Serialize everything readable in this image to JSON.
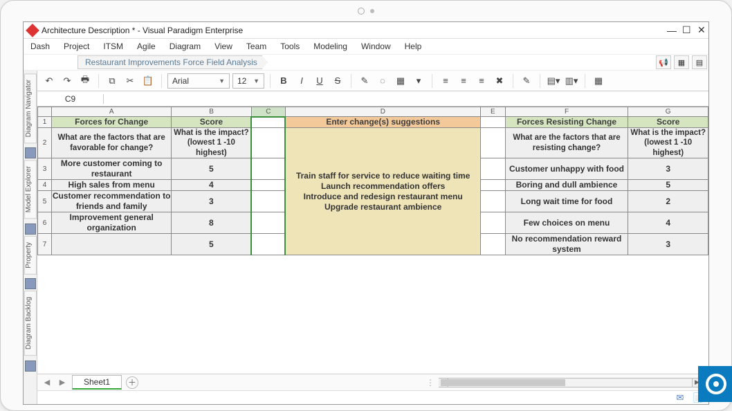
{
  "titlebar": {
    "title": "Architecture Description * - Visual Paradigm Enterprise"
  },
  "menu": [
    "Dash",
    "Project",
    "ITSM",
    "Agile",
    "Diagram",
    "View",
    "Team",
    "Tools",
    "Modeling",
    "Window",
    "Help"
  ],
  "breadcrumb": "Restaurant Improvements Force Field Analysis",
  "sidetabs": [
    "Diagram Navigator",
    "Model Explorer",
    "Property",
    "Diagram Backlog"
  ],
  "toolbar": {
    "font": "Arial",
    "size": "12"
  },
  "cellref": "C9",
  "sheet_tab": "Sheet1",
  "columns": [
    "A",
    "B",
    "C",
    "D",
    "E",
    "F",
    "G"
  ],
  "headers": {
    "forces_for_change": "Forces for Change",
    "score_left": "Score",
    "suggestions": "Enter change(s) suggestions",
    "forces_resisting": "Forces Resisting Change",
    "score_right": "Score"
  },
  "subheaders": {
    "left_factor": "What are the factors that are favorable for change?",
    "left_impact": "What is the impact? (lowest 1 -10 highest)",
    "right_factor": "What are the factors that are resisting change?",
    "right_impact": "What is the impact? (lowest 1 -10 highest)"
  },
  "center_text": "Train staff for service to reduce waiting time\nLaunch recommendation offers\nIntroduce and redesign restaurant menu\nUpgrade restaurant ambience",
  "rows": [
    {
      "n": "3",
      "left": "More customer coming to restaurant",
      "ls": "5",
      "right": "Customer unhappy with food",
      "rs": "3"
    },
    {
      "n": "4",
      "left": "High sales from menu",
      "ls": "4",
      "right": "Boring and dull ambience",
      "rs": "5"
    },
    {
      "n": "5",
      "left": "Customer recommendation to friends and family",
      "ls": "3",
      "right": "Long wait time for food",
      "rs": "2"
    },
    {
      "n": "6",
      "left": "Improvement general organization",
      "ls": "8",
      "right": "Few choices on menu",
      "rs": "4"
    },
    {
      "n": "7",
      "left": "",
      "ls": "5",
      "right": "No recommendation reward system",
      "rs": "3"
    }
  ],
  "chart_data": {
    "type": "table",
    "title": "Restaurant Improvements Force Field Analysis",
    "suggestions": [
      "Train staff for service to reduce waiting time",
      "Launch recommendation offers",
      "Introduce and redesign restaurant menu",
      "Upgrade restaurant ambience"
    ],
    "forces_for_change": [
      {
        "factor": "More customer coming to restaurant",
        "score": 5
      },
      {
        "factor": "High sales from menu",
        "score": 4
      },
      {
        "factor": "Customer recommendation to friends and family",
        "score": 3
      },
      {
        "factor": "Improvement general organization",
        "score": 8
      },
      {
        "factor": "",
        "score": 5
      }
    ],
    "forces_resisting_change": [
      {
        "factor": "Customer unhappy with food",
        "score": 3
      },
      {
        "factor": "Boring and dull ambience",
        "score": 5
      },
      {
        "factor": "Long wait time for food",
        "score": 2
      },
      {
        "factor": "Few choices on menu",
        "score": 4
      },
      {
        "factor": "No recommendation reward system",
        "score": 3
      }
    ],
    "score_scale": "1 (lowest) – 10 (highest)"
  }
}
